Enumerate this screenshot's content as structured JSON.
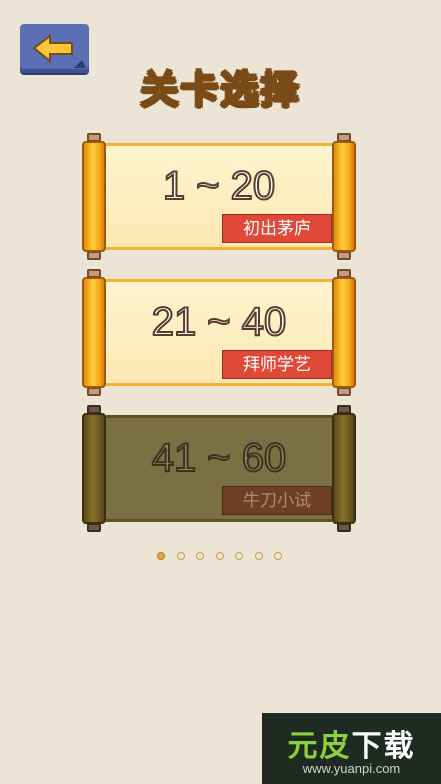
{
  "header": {
    "back_icon": "arrow-left-icon",
    "title": "关卡选择"
  },
  "levels": [
    {
      "range": "1 ~ 20",
      "name": "初出茅庐",
      "state": "unlocked"
    },
    {
      "range": "21 ~ 40",
      "name": "拜师学艺",
      "state": "unlocked"
    },
    {
      "range": "41 ~ 60",
      "name": "牛刀小试",
      "state": "locked"
    }
  ],
  "pagination": {
    "total_pages": 7,
    "current_page": 1
  },
  "watermark": {
    "brand_left": "元皮",
    "brand_right": "下载",
    "url": "www.yuanpi.com"
  },
  "colors": {
    "background": "#ece5d6",
    "title": "#f5c43a",
    "tag": "#e0493a",
    "back_button": "#5a6fb4"
  }
}
